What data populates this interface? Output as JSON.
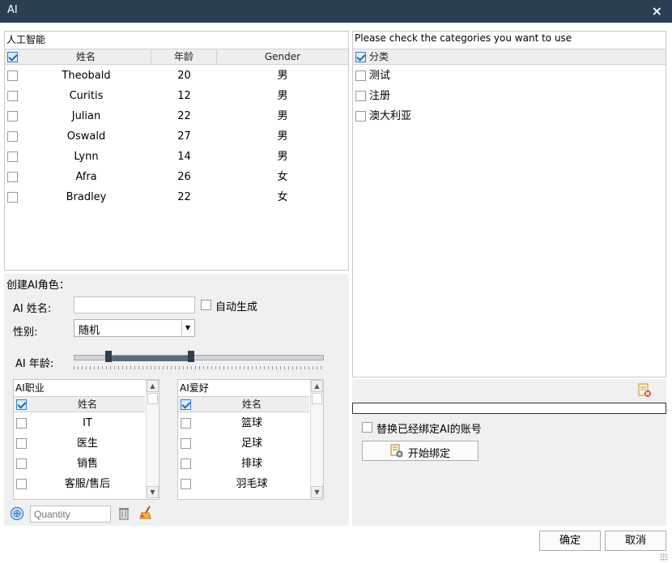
{
  "window": {
    "title": "AI",
    "close_glyph": "×"
  },
  "ai_grid": {
    "caption": "人工智能",
    "columns": {
      "name": "姓名",
      "age": "年龄",
      "gender": "Gender"
    },
    "header_checked": true,
    "rows": [
      {
        "name": "Theobald",
        "age": "20",
        "gender": "男"
      },
      {
        "name": "Curitis",
        "age": "12",
        "gender": "男"
      },
      {
        "name": "Julian",
        "age": "22",
        "gender": "男"
      },
      {
        "name": "Oswald",
        "age": "27",
        "gender": "男"
      },
      {
        "name": "Lynn",
        "age": "14",
        "gender": "男"
      },
      {
        "name": "Afra",
        "age": "26",
        "gender": "女"
      },
      {
        "name": "Bradley",
        "age": "22",
        "gender": "女"
      }
    ]
  },
  "category_grid": {
    "caption": "Please check the categories you want to use",
    "column": "分类",
    "header_checked": true,
    "rows": [
      {
        "name": "测试"
      },
      {
        "name": "注册"
      },
      {
        "name": "澳大利亚"
      }
    ]
  },
  "create_form": {
    "heading": "创建AI角色：",
    "name_label": "AI 姓名:",
    "name_value": "",
    "auto_generate_label": "自动生成",
    "gender_label": "性别:",
    "gender_value": "随机",
    "age_label": "AI 年龄:",
    "age_range_fraction": [
      0.14,
      0.47
    ]
  },
  "job_grid": {
    "caption": "AI职业",
    "column": "姓名",
    "header_checked": true,
    "rows": [
      {
        "name": "IT"
      },
      {
        "name": "医生"
      },
      {
        "name": "销售"
      },
      {
        "name": "客服/售后"
      }
    ]
  },
  "hobby_grid": {
    "caption": "AI爱好",
    "column": "姓名",
    "header_checked": true,
    "rows": [
      {
        "name": "篮球"
      },
      {
        "name": "足球"
      },
      {
        "name": "排球"
      },
      {
        "name": "羽毛球"
      }
    ]
  },
  "bottom_tools": {
    "quantity_placeholder": "Quantity"
  },
  "binding": {
    "replace_label": "替换已经绑定AI的账号",
    "start_button": "开始绑定"
  },
  "footer": {
    "ok": "确定",
    "cancel": "取消"
  },
  "icons": {
    "add": "add-circle-icon",
    "delete": "trash-icon",
    "clear": "broom-icon",
    "remove_category": "document-delete-icon",
    "bind": "document-gear-icon"
  },
  "colors": {
    "titlebar": "#2b3f52",
    "accent": "#3a7dc9"
  }
}
